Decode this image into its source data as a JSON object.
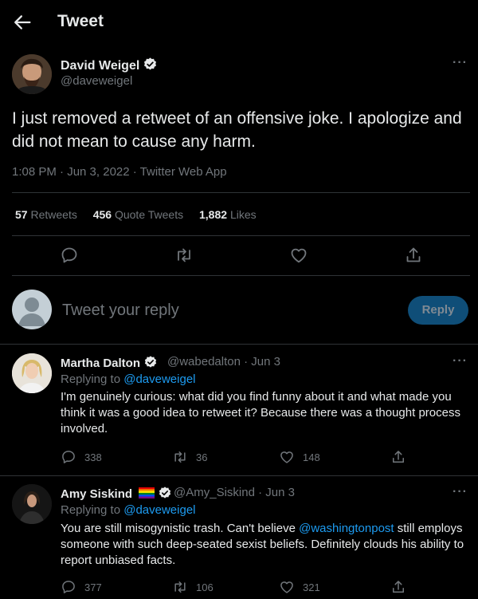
{
  "header": {
    "title": "Tweet"
  },
  "tweet": {
    "author_name": "David Weigel",
    "author_handle": "@daveweigel",
    "text": "I just removed a retweet of an offensive joke. I apologize and did not mean to cause any harm.",
    "meta": "1:08 PM · Jun 3, 2022 · Twitter Web App",
    "stats": {
      "retweets_count": "57",
      "retweets_label": "Retweets",
      "quotes_count": "456",
      "quotes_label": "Quote Tweets",
      "likes_count": "1,882",
      "likes_label": "Likes"
    }
  },
  "composer": {
    "placeholder": "Tweet your reply",
    "button_label": "Reply"
  },
  "replies": [
    {
      "name": "Martha Dalton",
      "handle_date": "@wabedalton · Jun 3",
      "replying_prefix": "Replying to ",
      "replying_handle": "@daveweigel",
      "text": "I'm genuinely curious: what did you find funny about it and what made you think it was a good idea to retweet it? Because there was a thought process involved.",
      "reply_count": "338",
      "retweet_count": "36",
      "like_count": "148"
    },
    {
      "name": "Amy Siskind",
      "handle_date": "@Amy_Siskind · Jun 3",
      "replying_prefix": "Replying to ",
      "replying_handle": "@daveweigel",
      "text_before": "You are still misogynistic trash. Can't believe ",
      "text_link": "@washingtonpost",
      "text_after": " still employs someone with such deep-seated sexist beliefs. Definitely clouds his ability to report unbiased facts.",
      "reply_count": "377",
      "retweet_count": "106",
      "like_count": "321"
    }
  ],
  "icons": {
    "back": "back-arrow-icon",
    "verified": "verified-badge-icon",
    "more": "more-icon",
    "reply": "reply-icon",
    "retweet": "retweet-icon",
    "like": "like-icon",
    "share": "share-icon",
    "flag": "rainbow-flag-icon"
  },
  "colors": {
    "background": "#000000",
    "text": "#e7e9ea",
    "muted": "#71767b",
    "accent": "#1d9bf0",
    "divider": "#2f3336"
  }
}
